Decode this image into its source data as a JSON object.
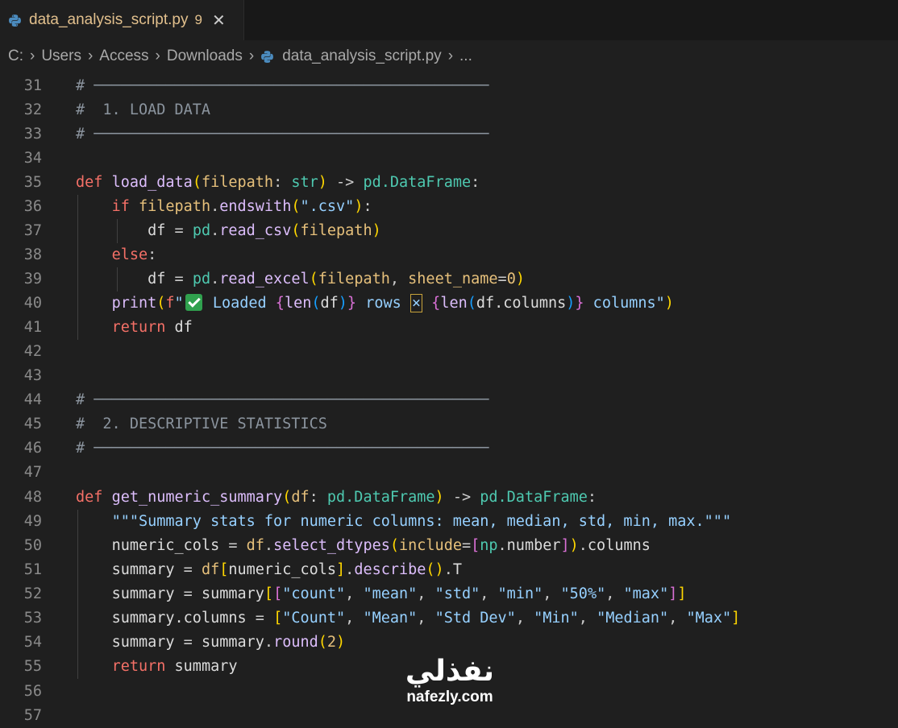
{
  "tab": {
    "filename": "data_analysis_script.py",
    "problem_count": "9",
    "close_glyph": "✕"
  },
  "breadcrumb": {
    "parts": [
      "C:",
      "Users",
      "Access",
      "Downloads"
    ],
    "file": "data_analysis_script.py",
    "more": "...",
    "separator": "›"
  },
  "editor": {
    "line_numbers": [
      "31",
      "32",
      "33",
      "34",
      "35",
      "36",
      "37",
      "38",
      "39",
      "40",
      "41",
      "42",
      "43",
      "44",
      "45",
      "46",
      "47",
      "48",
      "49",
      "50",
      "51",
      "52",
      "53",
      "54",
      "55",
      "56",
      "57"
    ],
    "rule": "# ────────────────────────────────────────────",
    "section1": "#  1. LOAD DATA",
    "section2": "#  2. DESCRIPTIVE STATISTICS"
  },
  "watermark": {
    "arabic": "نفذلي",
    "latin": "nafezly.com"
  },
  "colors": {
    "background": "#1f1f1f",
    "keyword": "#f47067",
    "function": "#dcbdfb",
    "class": "#4ec9b0",
    "string": "#96d0ff"
  }
}
